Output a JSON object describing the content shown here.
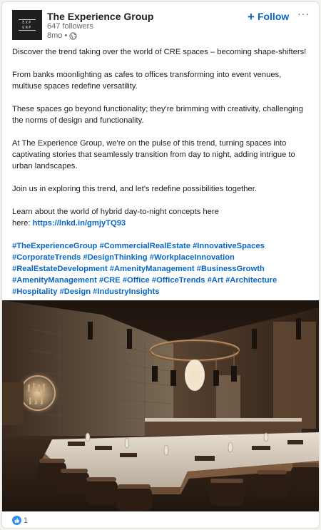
{
  "post": {
    "company_name": "The Experience Group",
    "followers": "647 followers",
    "age": "8mo •",
    "follow_label": "Follow",
    "more_label": "···",
    "logo_lines": [
      "EXP",
      "GRP"
    ]
  },
  "content": {
    "p1": "Discover the trend taking over the world of CRE spaces – becoming shape-shifters!",
    "p2": "From banks moonlighting as cafes to offices transforming into event venues, multiuse spaces redefine versatility.",
    "p3": "These spaces go beyond functionality; they're brimming with creativity, challenging the norms of design and functionality.",
    "p4": "At The Experience Group, we're on the pulse of this trend, turning spaces into captivating stories that seamlessly transition from day to night, adding intrigue to urban landscapes.",
    "p5": "Join us in exploring this trend, and let's redefine possibilities together.",
    "p6_line1": "Learn about the world of hybrid day-to-night concepts here",
    "p6_prefix": "here: ",
    "link": "https://lnkd.in/gmjyTQ93",
    "hashtags": [
      "#TheExperienceGroup",
      "#CommercialRealEstate",
      "#InnovativeSpaces",
      "#CorporateTrends",
      "#DesignThinking",
      "#WorkplaceInnovation",
      "#RealEstateDevelopment",
      "#AmenityManagement",
      "#BusinessGrowth",
      "#AmenityManagement",
      "#CRE",
      "#Office",
      "#OfficeTrends",
      "#Art",
      "#Architecture",
      "#Hospitality",
      "#Design",
      "#IndustryInsights"
    ]
  },
  "reactions": {
    "count": "1",
    "icon": "like-icon"
  },
  "colors": {
    "accent": "#0a66c2",
    "text": "#1d1d1d",
    "muted": "#666666"
  }
}
